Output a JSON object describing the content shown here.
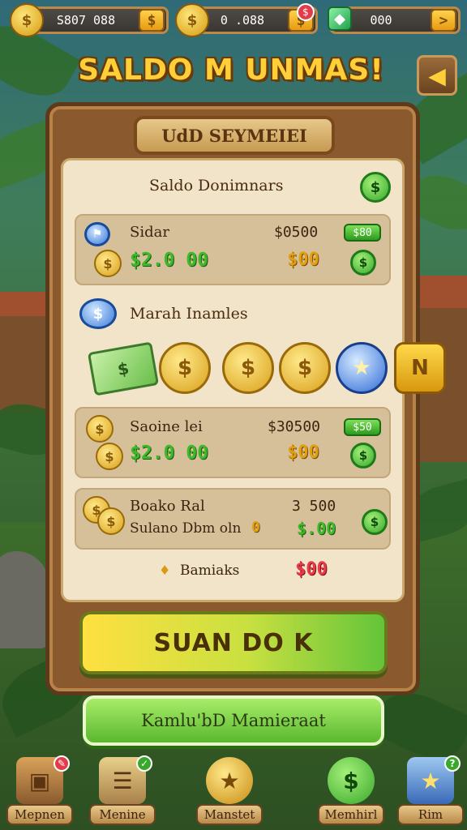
{
  "topbar": {
    "coins_value": "S807 088",
    "coins_plus": "$",
    "gold_value": "0 .088",
    "gold_plus": "$",
    "gems_value": "000",
    "gems_plus": ">",
    "alert": "$"
  },
  "title": "SALDO M UNMAS!",
  "back_icon": "arrow-left-icon",
  "panel": {
    "banner": "UdD SEYMEIEI",
    "section1_title": "Saldo Donimnars",
    "section1_coin": "$",
    "row1": {
      "label": "Sidar",
      "amount": "$2.0 00",
      "price_top": "$0500",
      "pill": "$80",
      "price": "$00",
      "coin": "$"
    },
    "section2_title": "Marah Inamles",
    "section2_coin": "$",
    "shop_items": [
      {
        "name": "cash-stack",
        "glyph": "$"
      },
      {
        "name": "gold-coin",
        "glyph": "$"
      },
      {
        "name": "gold-coin",
        "glyph": "$"
      },
      {
        "name": "gold-coin",
        "glyph": "$"
      },
      {
        "name": "blue-star-coin",
        "glyph": "★"
      },
      {
        "name": "gold-n-coin",
        "glyph": "N"
      }
    ],
    "row2": {
      "label": "Saoine lei",
      "amount": "$2.0 00",
      "price_top": "$30500",
      "pill": "$50",
      "price": "$00",
      "coin": "$"
    },
    "row3": {
      "label": "Boako Ral",
      "sublabel": "Sulano Dbm oln",
      "zero": "0",
      "price_top": "3 500",
      "price": "$.00",
      "coin": "$"
    },
    "bonus": {
      "label": "Bamiaks",
      "price": "$00",
      "icon": "♦"
    }
  },
  "main_button": "SUAN DO K",
  "secondary_button": "Kamlu'bD Mamieraat",
  "nav": [
    {
      "label": "Mepnen",
      "icon": "chest-icon",
      "glyph": "▣",
      "badge": "✎",
      "badge_color": "#e23c4a"
    },
    {
      "label": "Menine",
      "icon": "scroll-icon",
      "glyph": "☰",
      "badge": "✓",
      "badge_color": "#3aa82a"
    },
    {
      "label": "Manstet",
      "icon": "star-medal-icon",
      "glyph": "★",
      "badge": "",
      "badge_color": ""
    },
    {
      "label": "Memhirl",
      "icon": "dollar-coin-icon",
      "glyph": "$",
      "badge": "",
      "badge_color": ""
    },
    {
      "label": "Rim",
      "icon": "star-card-icon",
      "glyph": "★",
      "badge": "?",
      "badge_color": "#3aa82a"
    }
  ],
  "colors": {
    "accent_gold": "#ffcf3a",
    "accent_green": "#3fb82a",
    "alert_red": "#e83a4a",
    "wood": "#8a5a2e"
  }
}
